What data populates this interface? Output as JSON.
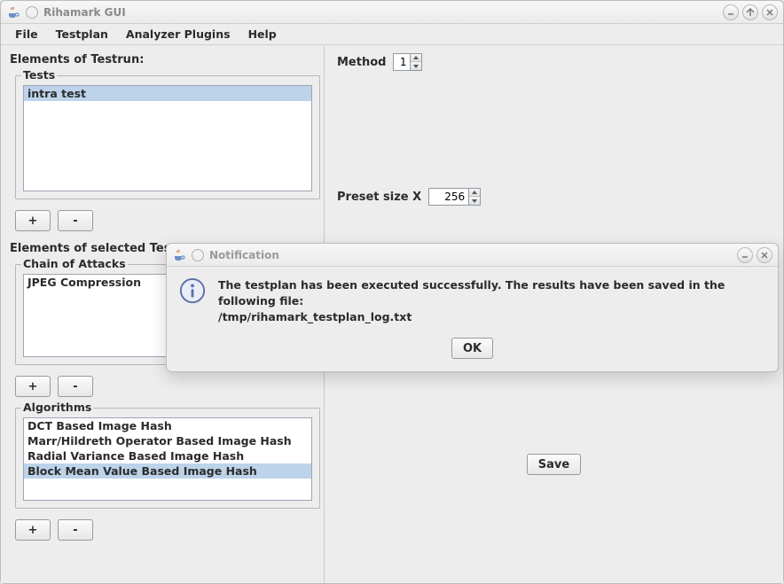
{
  "window": {
    "title": "Rihamark GUI"
  },
  "menubar": {
    "file": "File",
    "testplan": "Testplan",
    "analyzer": "Analyzer Plugins",
    "help": "Help"
  },
  "left": {
    "heading_testrun": "Elements of Testrun:",
    "tests_label": "Tests",
    "tests": [
      "intra test"
    ],
    "tests_selected": 0,
    "add": "+",
    "remove": "-",
    "heading_selected": "Elements of selected Test:",
    "attacks_label": "Chain of Attacks",
    "attacks": [
      "JPEG Compression"
    ],
    "attacks_selected": -1,
    "algorithms_label": "Algorithms",
    "algorithms": [
      "DCT Based Image Hash",
      "Marr/Hildreth Operator Based Image Hash",
      "Radial Variance Based Image Hash",
      "Block Mean Value Based Image Hash"
    ],
    "algorithms_selected": 3
  },
  "right": {
    "method_label": "Method",
    "method_value": "1",
    "preset_label": "Preset size X",
    "preset_value": "256",
    "save": "Save"
  },
  "dialog": {
    "title": "Notification",
    "message": "The testplan has been executed successfully. The results have been saved in the following file:",
    "path": "/tmp/rihamark_testplan_log.txt",
    "ok": "OK"
  }
}
